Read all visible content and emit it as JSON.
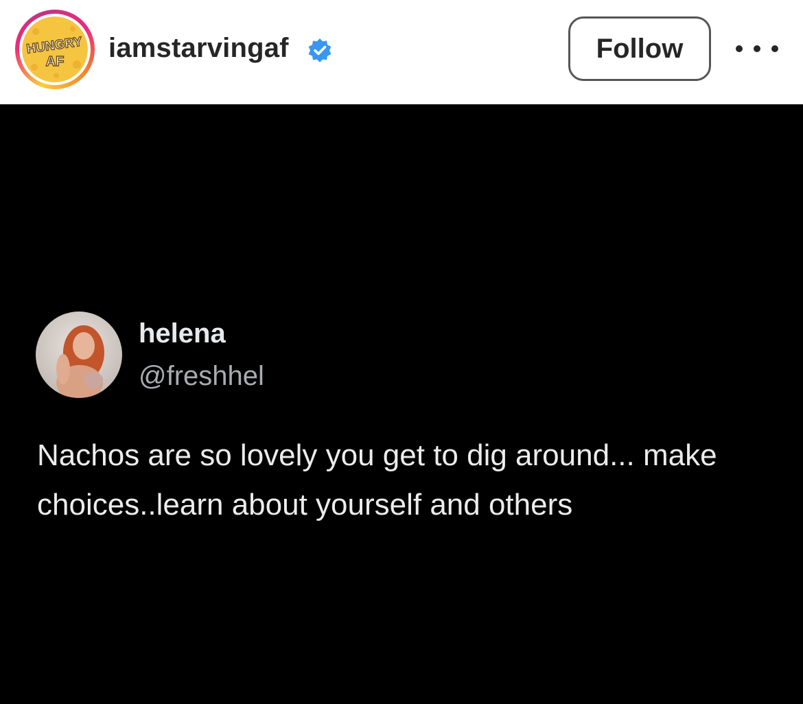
{
  "header": {
    "account_name": "iamstarvingaf",
    "avatar_logo": "HUNGRY AF",
    "verified_icon": "verified-badge-icon",
    "follow_label": "Follow",
    "more_icon": "more-options-icon"
  },
  "post": {
    "tweet": {
      "display_name": "helena",
      "handle": "@freshhel",
      "text": "Nachos are so lovely you get to dig around... make choices..learn about yourself and others"
    }
  },
  "colors": {
    "verified_blue": "#3897f0",
    "post_background": "#000000",
    "logo_yellow": "#f5c542"
  }
}
